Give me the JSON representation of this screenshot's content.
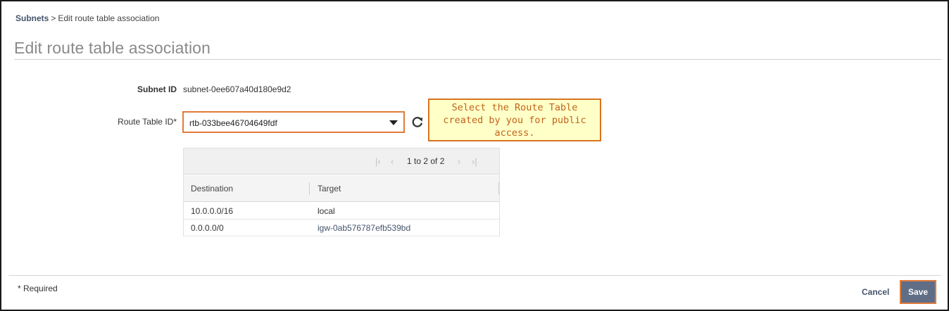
{
  "breadcrumb": {
    "parent": "Subnets",
    "separator": ">",
    "current": "Edit route table association"
  },
  "page": {
    "title": "Edit route table association"
  },
  "form": {
    "subnet_label": "Subnet ID",
    "subnet_value": "subnet-0ee607a40d180e9d2",
    "route_table_label": "Route Table ID*",
    "route_table_value": "rtb-033bee46704649fdf",
    "refresh_icon": "refresh-icon",
    "dropdown_icon": "caret-down-icon"
  },
  "callout": {
    "text_line1": "Select the Route Table",
    "text_line2": "created by you for public",
    "text_line3": "access."
  },
  "route_table": {
    "pagination_text": "1 to 2 of 2",
    "columns": [
      "Destination",
      "Target"
    ],
    "rows": [
      {
        "destination": "10.0.0.0/16",
        "target": "local"
      },
      {
        "destination": "0.0.0.0/0",
        "target": "igw-0ab576787efb539bd"
      }
    ]
  },
  "footer": {
    "required_note": "* Required",
    "cancel_label": "Cancel",
    "save_label": "Save"
  },
  "colors": {
    "highlight_border": "#e07b39",
    "callout_background": "#ffffc8",
    "save_button": "#5f6e86",
    "link": "#44536c"
  }
}
